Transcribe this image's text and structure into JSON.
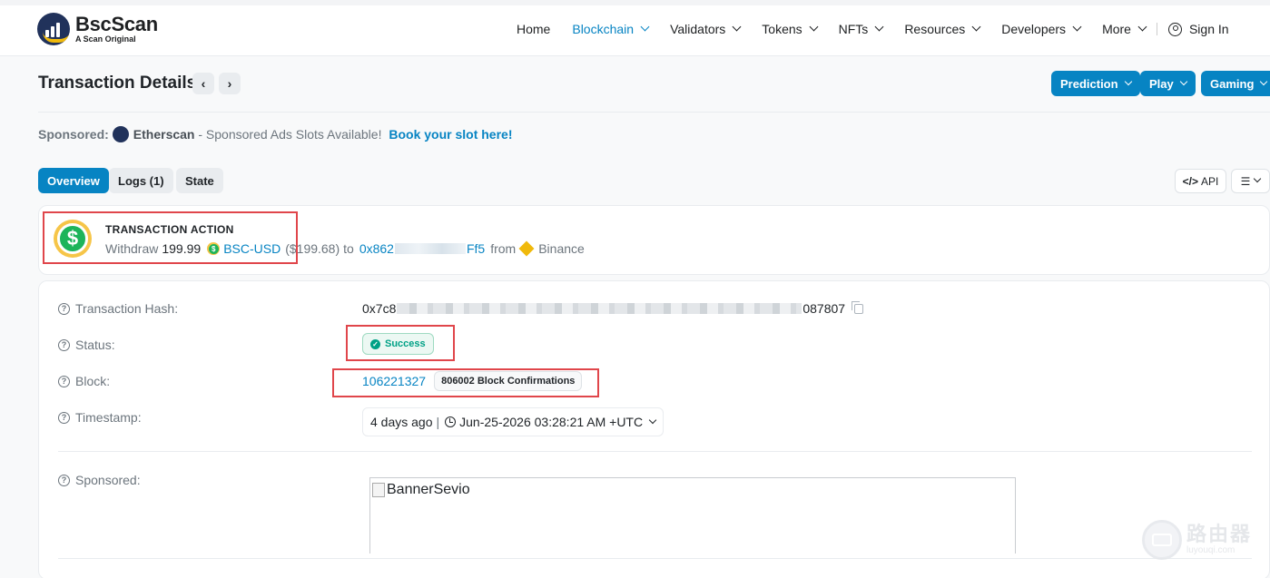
{
  "header": {
    "logo_title": "BscScan",
    "logo_subtitle": "A Scan Original",
    "nav": [
      {
        "label": "Home",
        "dropdown": false,
        "active": false
      },
      {
        "label": "Blockchain",
        "dropdown": true,
        "active": true
      },
      {
        "label": "Validators",
        "dropdown": true,
        "active": false
      },
      {
        "label": "Tokens",
        "dropdown": true,
        "active": false
      },
      {
        "label": "NFTs",
        "dropdown": true,
        "active": false
      },
      {
        "label": "Resources",
        "dropdown": true,
        "active": false
      },
      {
        "label": "Developers",
        "dropdown": true,
        "active": false
      },
      {
        "label": "More",
        "dropdown": true,
        "active": false
      }
    ],
    "sign_in": "Sign In"
  },
  "page": {
    "title": "Transaction Details",
    "prev_icon": "chevron-left-icon",
    "next_icon": "chevron-right-icon",
    "buttons": [
      "Prediction",
      "Play",
      "Gaming"
    ]
  },
  "sponsored_bar": {
    "label": "Sponsored:",
    "brand": "Etherscan",
    "text": " - Sponsored Ads Slots Available! ",
    "link": "Book your slot here!"
  },
  "tabs": [
    {
      "label": "Overview",
      "active": true
    },
    {
      "label": "Logs (1)",
      "active": false
    },
    {
      "label": "State",
      "active": false
    }
  ],
  "tools": {
    "api": "API",
    "list_icon": "list-check-icon"
  },
  "action": {
    "title": "TRANSACTION ACTION",
    "verb": "Withdraw",
    "amount": "199.99",
    "token": "BSC-USD",
    "usd": "($199.68)",
    "to_word": "to",
    "to_addr_prefix": "0x862",
    "to_addr_suffix": "Ff5",
    "from_word": "from",
    "from_name": "Binance"
  },
  "details": {
    "hash_label": "Transaction Hash:",
    "hash_prefix": "0x7c8",
    "hash_suffix": "087807",
    "status_label": "Status:",
    "status": "Success",
    "block_label": "Block:",
    "block": "106221327",
    "confirmations": "806002 Block Confirmations",
    "timestamp_label": "Timestamp:",
    "timestamp_age": "4 days ago",
    "timestamp_sep": "|",
    "timestamp_full": "Jun-25-2026 03:28:21 AM +UTC",
    "sponsored_label": "Sponsored:",
    "banner_alt": "BannerSevio"
  },
  "watermark": {
    "cn": "路由器",
    "url": "luyouqi.com"
  },
  "colors": {
    "accent": "#0784c3",
    "success": "#00a186",
    "highlight": "#e0464b",
    "bnb": "#f0b90b"
  }
}
